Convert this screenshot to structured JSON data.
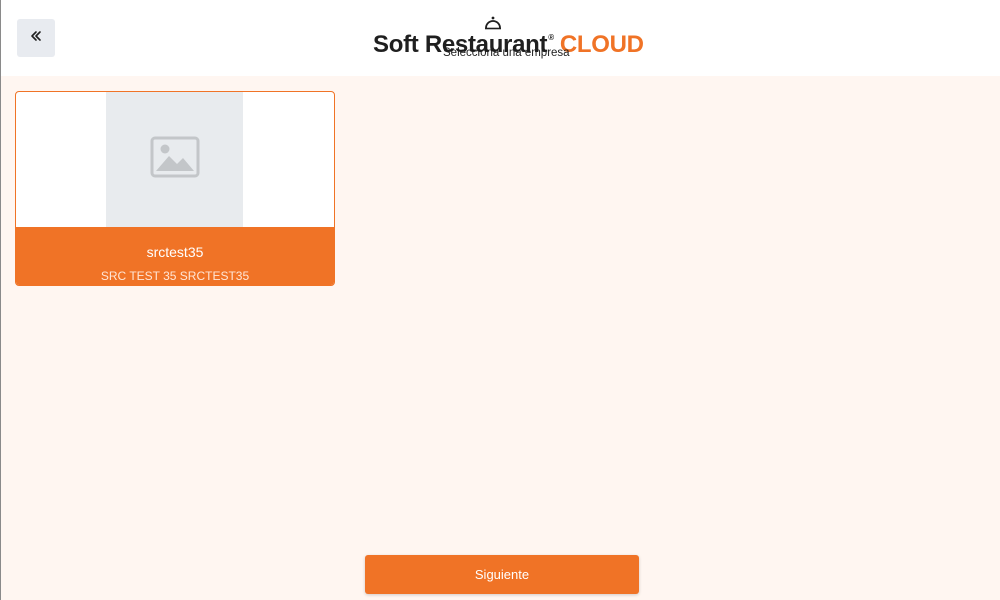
{
  "header": {
    "brand_main": "Soft Restaurant",
    "brand_reg": "®",
    "brand_cloud": "CLOUD",
    "subtitle": "Selecciona una empresa"
  },
  "back_button": {
    "icon": "double-chevron-left-icon"
  },
  "companies": [
    {
      "name": "srctest35",
      "description": "SRC TEST 35 SRCTEST35",
      "image_icon": "image-placeholder-icon"
    }
  ],
  "footer": {
    "next_label": "Siguiente"
  },
  "colors": {
    "accent": "#f07326",
    "page_background": "#fff6f1",
    "header_background": "#ffffff",
    "back_button_background": "#e8ebf0",
    "placeholder_background": "#e8ebee"
  }
}
